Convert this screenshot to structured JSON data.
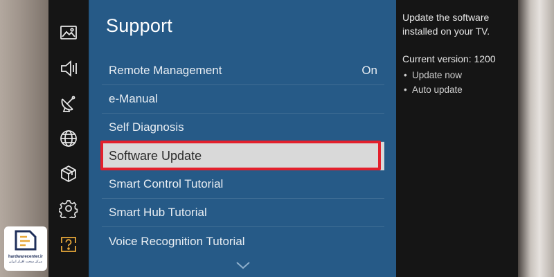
{
  "sidebar": {
    "icons": [
      "picture-icon",
      "sound-icon",
      "broadcast-icon",
      "network-icon",
      "apps-icon",
      "settings-icon",
      "support-icon"
    ],
    "active": "support-icon",
    "accent_color": "#e8a83a"
  },
  "panel": {
    "title": "Support",
    "items": [
      {
        "label": "Remote Management",
        "value": "On"
      },
      {
        "label": "e-Manual",
        "value": ""
      },
      {
        "label": "Self Diagnosis",
        "value": ""
      },
      {
        "label": "Software Update",
        "value": "",
        "selected": true
      },
      {
        "label": "Smart Control Tutorial",
        "value": ""
      },
      {
        "label": "Smart Hub Tutorial",
        "value": ""
      },
      {
        "label": "Voice Recognition Tutorial",
        "value": ""
      }
    ],
    "more_icon": "chevron-down-icon",
    "highlight_color": "#e3202c"
  },
  "info": {
    "description": "Update the software installed on your TV.",
    "version": "Current version: 1200",
    "options": [
      "Update now",
      "Auto update"
    ]
  },
  "watermark": {
    "text": "hardwarecenter.ir",
    "subtext": "مرکز سخت افزار ایران"
  }
}
